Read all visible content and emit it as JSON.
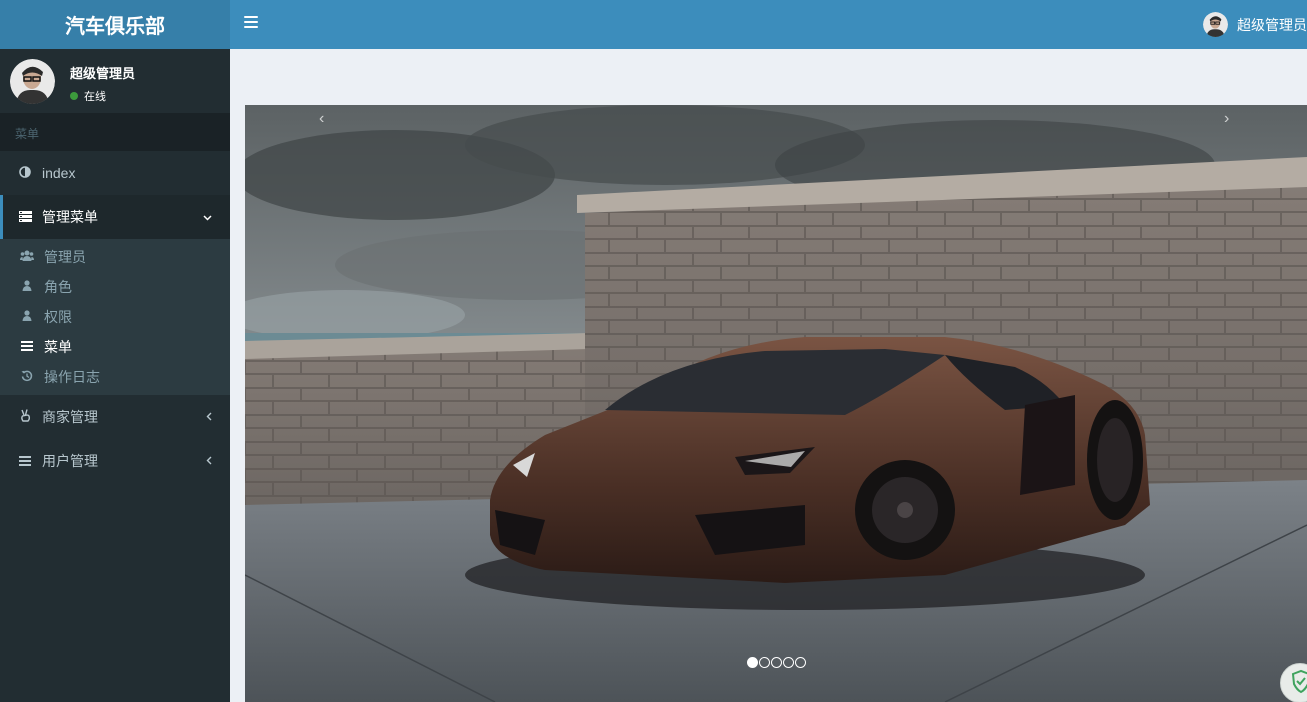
{
  "header": {
    "logo": "汽车俱乐部",
    "user_name": "超级管理员"
  },
  "sidebar": {
    "user": {
      "name": "超级管理员",
      "status": "在线"
    },
    "section_header": "菜单",
    "items": [
      {
        "label": "index",
        "icon": "adjust-icon"
      },
      {
        "label": "管理菜单",
        "icon": "list-icon",
        "expanded": true,
        "children": [
          {
            "label": "管理员",
            "icon": "users-icon"
          },
          {
            "label": "角色",
            "icon": "user-icon"
          },
          {
            "label": "权限",
            "icon": "user-icon"
          },
          {
            "label": "菜单",
            "icon": "bars-icon",
            "current": true
          },
          {
            "label": "操作日志",
            "icon": "history-icon"
          }
        ]
      },
      {
        "label": "商家管理",
        "icon": "hand-peace-icon"
      },
      {
        "label": "用户管理",
        "icon": "bars-icon"
      }
    ]
  },
  "carousel": {
    "prev": "‹",
    "next": "›",
    "slide_count": 5,
    "active_slide": 1
  },
  "colors": {
    "header": "#3c8dbc",
    "logo_bg": "#367fa9",
    "sidebar": "#222d32",
    "content_bg": "#ecf0f5"
  }
}
